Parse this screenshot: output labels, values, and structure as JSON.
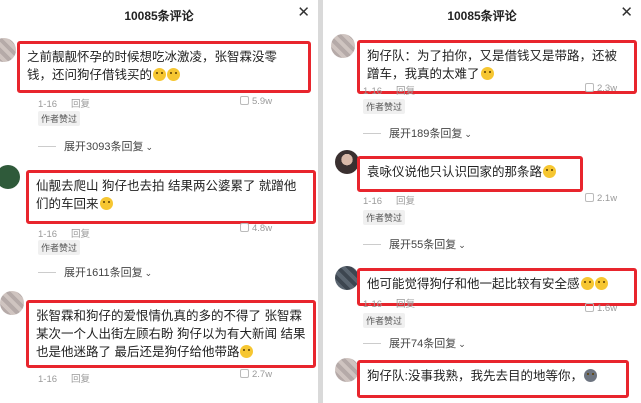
{
  "left": {
    "title": "10085条评论",
    "comments": [
      {
        "text": "之前靓靓怀孕的时候想吃冰激凌，张智霖没零钱，还问狗仔借钱买的",
        "date": "1-16",
        "reply": "回复",
        "likes": "5.9w",
        "badge": "作者赞过",
        "expand": "展开3093条回复"
      },
      {
        "text": "仙靓去爬山 狗仔也去拍 结果两公婆累了 就蹭他们的车回来",
        "date": "1-16",
        "reply": "回复",
        "likes": "4.8w",
        "badge": "作者赞过",
        "expand": "展开1611条回复"
      },
      {
        "text": "张智霖和狗仔的爱恨情仇真的多的不得了 张智霖某次一个人出街左顾右盼 狗仔以为有大新闻 结果也是他迷路了 最后还是狗仔给他带路",
        "date": "1-16",
        "reply": "回复",
        "likes": "2.7w"
      }
    ]
  },
  "right": {
    "title": "10085条评论",
    "comments": [
      {
        "text": "狗仔队：为了拍你，又是借钱又是带路，还被蹭车，我真的太难了",
        "date": "1-16",
        "reply": "回复",
        "likes": "2.3w",
        "badge": "作者赞过",
        "expand": "展开189条回复"
      },
      {
        "text": "袁咏仪说他只认识回家的那条路",
        "date": "1-16",
        "reply": "回复",
        "likes": "2.1w",
        "badge": "作者赞过",
        "expand": "展开55条回复"
      },
      {
        "text": "他可能觉得狗仔和他一起比较有安全感",
        "date": "1-16",
        "reply": "回复",
        "likes": "1.6w",
        "badge": "作者赞过",
        "expand": "展开74条回复"
      },
      {
        "text": "狗仔队:没事我熟，我先去目的地等你，"
      }
    ]
  },
  "icons": {
    "close": "close-icon",
    "emoji": "grin-emoji-icon",
    "husky": "husky-emoji-icon",
    "like": "thumb-icon"
  }
}
